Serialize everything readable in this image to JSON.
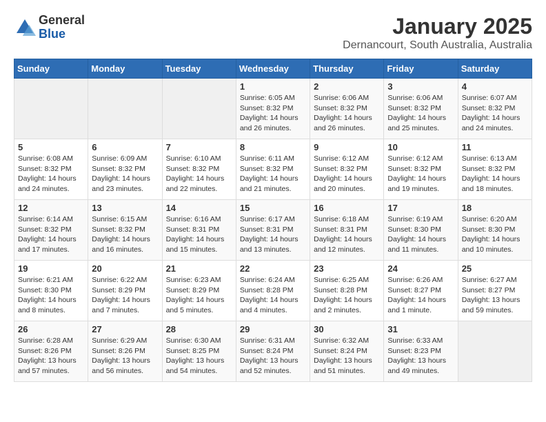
{
  "logo": {
    "general": "General",
    "blue": "Blue"
  },
  "title": "January 2025",
  "location": "Dernancourt, South Australia, Australia",
  "weekdays": [
    "Sunday",
    "Monday",
    "Tuesday",
    "Wednesday",
    "Thursday",
    "Friday",
    "Saturday"
  ],
  "weeks": [
    [
      {
        "day": "",
        "info": ""
      },
      {
        "day": "",
        "info": ""
      },
      {
        "day": "",
        "info": ""
      },
      {
        "day": "1",
        "info": "Sunrise: 6:05 AM\nSunset: 8:32 PM\nDaylight: 14 hours\nand 26 minutes."
      },
      {
        "day": "2",
        "info": "Sunrise: 6:06 AM\nSunset: 8:32 PM\nDaylight: 14 hours\nand 26 minutes."
      },
      {
        "day": "3",
        "info": "Sunrise: 6:06 AM\nSunset: 8:32 PM\nDaylight: 14 hours\nand 25 minutes."
      },
      {
        "day": "4",
        "info": "Sunrise: 6:07 AM\nSunset: 8:32 PM\nDaylight: 14 hours\nand 24 minutes."
      }
    ],
    [
      {
        "day": "5",
        "info": "Sunrise: 6:08 AM\nSunset: 8:32 PM\nDaylight: 14 hours\nand 24 minutes."
      },
      {
        "day": "6",
        "info": "Sunrise: 6:09 AM\nSunset: 8:32 PM\nDaylight: 14 hours\nand 23 minutes."
      },
      {
        "day": "7",
        "info": "Sunrise: 6:10 AM\nSunset: 8:32 PM\nDaylight: 14 hours\nand 22 minutes."
      },
      {
        "day": "8",
        "info": "Sunrise: 6:11 AM\nSunset: 8:32 PM\nDaylight: 14 hours\nand 21 minutes."
      },
      {
        "day": "9",
        "info": "Sunrise: 6:12 AM\nSunset: 8:32 PM\nDaylight: 14 hours\nand 20 minutes."
      },
      {
        "day": "10",
        "info": "Sunrise: 6:12 AM\nSunset: 8:32 PM\nDaylight: 14 hours\nand 19 minutes."
      },
      {
        "day": "11",
        "info": "Sunrise: 6:13 AM\nSunset: 8:32 PM\nDaylight: 14 hours\nand 18 minutes."
      }
    ],
    [
      {
        "day": "12",
        "info": "Sunrise: 6:14 AM\nSunset: 8:32 PM\nDaylight: 14 hours\nand 17 minutes."
      },
      {
        "day": "13",
        "info": "Sunrise: 6:15 AM\nSunset: 8:32 PM\nDaylight: 14 hours\nand 16 minutes."
      },
      {
        "day": "14",
        "info": "Sunrise: 6:16 AM\nSunset: 8:31 PM\nDaylight: 14 hours\nand 15 minutes."
      },
      {
        "day": "15",
        "info": "Sunrise: 6:17 AM\nSunset: 8:31 PM\nDaylight: 14 hours\nand 13 minutes."
      },
      {
        "day": "16",
        "info": "Sunrise: 6:18 AM\nSunset: 8:31 PM\nDaylight: 14 hours\nand 12 minutes."
      },
      {
        "day": "17",
        "info": "Sunrise: 6:19 AM\nSunset: 8:30 PM\nDaylight: 14 hours\nand 11 minutes."
      },
      {
        "day": "18",
        "info": "Sunrise: 6:20 AM\nSunset: 8:30 PM\nDaylight: 14 hours\nand 10 minutes."
      }
    ],
    [
      {
        "day": "19",
        "info": "Sunrise: 6:21 AM\nSunset: 8:30 PM\nDaylight: 14 hours\nand 8 minutes."
      },
      {
        "day": "20",
        "info": "Sunrise: 6:22 AM\nSunset: 8:29 PM\nDaylight: 14 hours\nand 7 minutes."
      },
      {
        "day": "21",
        "info": "Sunrise: 6:23 AM\nSunset: 8:29 PM\nDaylight: 14 hours\nand 5 minutes."
      },
      {
        "day": "22",
        "info": "Sunrise: 6:24 AM\nSunset: 8:28 PM\nDaylight: 14 hours\nand 4 minutes."
      },
      {
        "day": "23",
        "info": "Sunrise: 6:25 AM\nSunset: 8:28 PM\nDaylight: 14 hours\nand 2 minutes."
      },
      {
        "day": "24",
        "info": "Sunrise: 6:26 AM\nSunset: 8:27 PM\nDaylight: 14 hours\nand 1 minute."
      },
      {
        "day": "25",
        "info": "Sunrise: 6:27 AM\nSunset: 8:27 PM\nDaylight: 13 hours\nand 59 minutes."
      }
    ],
    [
      {
        "day": "26",
        "info": "Sunrise: 6:28 AM\nSunset: 8:26 PM\nDaylight: 13 hours\nand 57 minutes."
      },
      {
        "day": "27",
        "info": "Sunrise: 6:29 AM\nSunset: 8:26 PM\nDaylight: 13 hours\nand 56 minutes."
      },
      {
        "day": "28",
        "info": "Sunrise: 6:30 AM\nSunset: 8:25 PM\nDaylight: 13 hours\nand 54 minutes."
      },
      {
        "day": "29",
        "info": "Sunrise: 6:31 AM\nSunset: 8:24 PM\nDaylight: 13 hours\nand 52 minutes."
      },
      {
        "day": "30",
        "info": "Sunrise: 6:32 AM\nSunset: 8:24 PM\nDaylight: 13 hours\nand 51 minutes."
      },
      {
        "day": "31",
        "info": "Sunrise: 6:33 AM\nSunset: 8:23 PM\nDaylight: 13 hours\nand 49 minutes."
      },
      {
        "day": "",
        "info": ""
      }
    ]
  ]
}
